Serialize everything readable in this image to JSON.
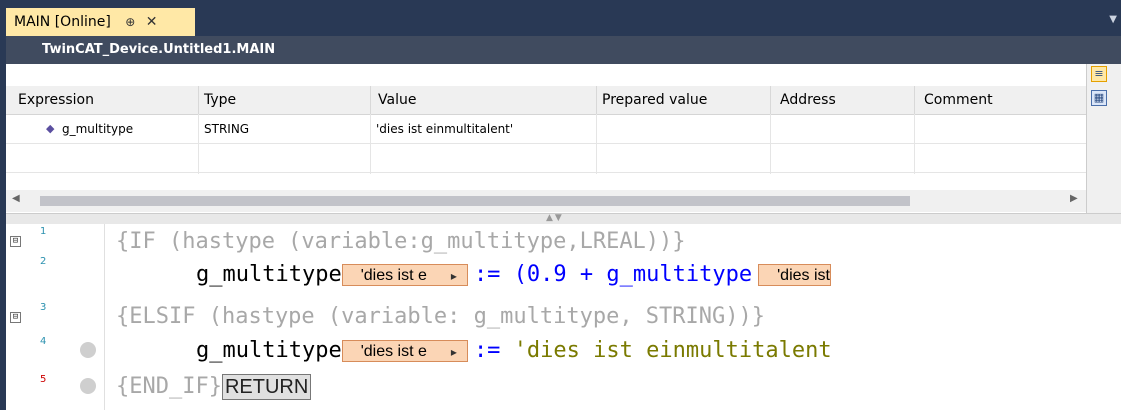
{
  "tab": {
    "title": "MAIN [Online]",
    "pin": "⊕",
    "close": "✕"
  },
  "path": "TwinCAT_Device.Untitled1.MAIN",
  "watch": {
    "columns": [
      "Expression",
      "Type",
      "Value",
      "Prepared value",
      "Address",
      "Comment"
    ],
    "rows": [
      {
        "expression": "g_multitype",
        "type": "STRING",
        "value": "'dies ist einmultitalent'",
        "prepared": "",
        "address": "",
        "comment": ""
      }
    ]
  },
  "editor": {
    "lines": [
      {
        "num": "1",
        "text": "{IF (hastype (variable:g_multitype,LREAL))}"
      },
      {
        "num": "2",
        "var": "g_multitype",
        "inline": "'dies ist e",
        "op": ":= ",
        "expr": "(0.9 + g_multitype",
        "inline2": "'dies ist"
      },
      {
        "num": "3",
        "text": "{ELSIF (hastype (variable: g_multitype, STRING))}"
      },
      {
        "num": "4",
        "var": "g_multitype",
        "inline": "'dies ist e",
        "op": ":= ",
        "expr": "'dies ist einmultitalent"
      },
      {
        "num": "5",
        "text": "{END_IF}",
        "ret": "RETURN"
      }
    ],
    "fold_plus": "⊟"
  }
}
